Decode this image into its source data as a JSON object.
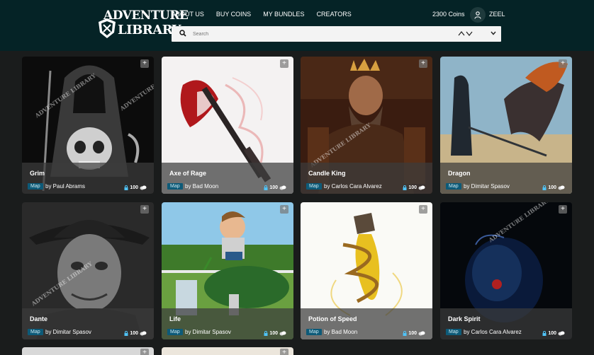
{
  "brand": {
    "line1": "ADVENTURE",
    "line2": "LIBRARY"
  },
  "nav": [
    "ABOUT US",
    "BUY COINS",
    "MY BUNDLES",
    "CREATORS"
  ],
  "account": {
    "coins": "2300 Coins",
    "username": "ZEEL"
  },
  "search": {
    "placeholder": "Search"
  },
  "cards": [
    {
      "title": "Grim",
      "badge": "Map",
      "author": "by Paul Abrams",
      "price": "100"
    },
    {
      "title": "Axe of Rage",
      "badge": "Map",
      "author": "by Bad Moon",
      "price": "100"
    },
    {
      "title": "Candle King",
      "badge": "Map",
      "author": "by Carlos Cara Alvarez",
      "price": "100"
    },
    {
      "title": "Dragon",
      "badge": "Map",
      "author": "by Dimitar Spasov",
      "price": "100"
    },
    {
      "title": "Dante",
      "badge": "Map",
      "author": "by Dimitar Spasov",
      "price": "100"
    },
    {
      "title": "Life",
      "badge": "Map",
      "author": "by Dimitar Spasov",
      "price": "100"
    },
    {
      "title": "Potion of Speed",
      "badge": "Map",
      "author": "by Bad Moon",
      "price": "100"
    },
    {
      "title": "Dark Spirit",
      "badge": "Map",
      "author": "by Carlos Cara Alvarez",
      "price": "100"
    }
  ],
  "colors": {
    "topbar": "#052326",
    "badge": "#0d5a78",
    "background": "#1a1c1c"
  }
}
